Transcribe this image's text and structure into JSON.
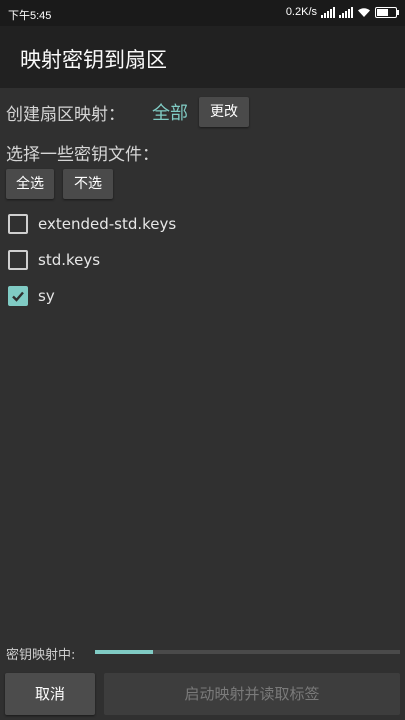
{
  "status_bar": {
    "time": "下午5:45",
    "net_speed": "0.2K/s"
  },
  "app_bar": {
    "title": "映射密钥到扇区"
  },
  "sector_mapping": {
    "label": "创建扇区映射：",
    "value": "全部",
    "change_button": "更改"
  },
  "key_files": {
    "label": "选择一些密钥文件：",
    "select_all_button": "全选",
    "select_none_button": "不选",
    "files": [
      {
        "name": "extended-std.keys",
        "checked": false
      },
      {
        "name": "std.keys",
        "checked": false
      },
      {
        "name": "sy",
        "checked": true
      }
    ]
  },
  "progress": {
    "label": "密钥映射中:",
    "fraction": 0.19
  },
  "actions": {
    "cancel_button": "取消",
    "start_button": "启动映射并读取标签"
  },
  "colors": {
    "accent": "#80cbc4",
    "background": "#303030",
    "app_bar": "#212121"
  }
}
